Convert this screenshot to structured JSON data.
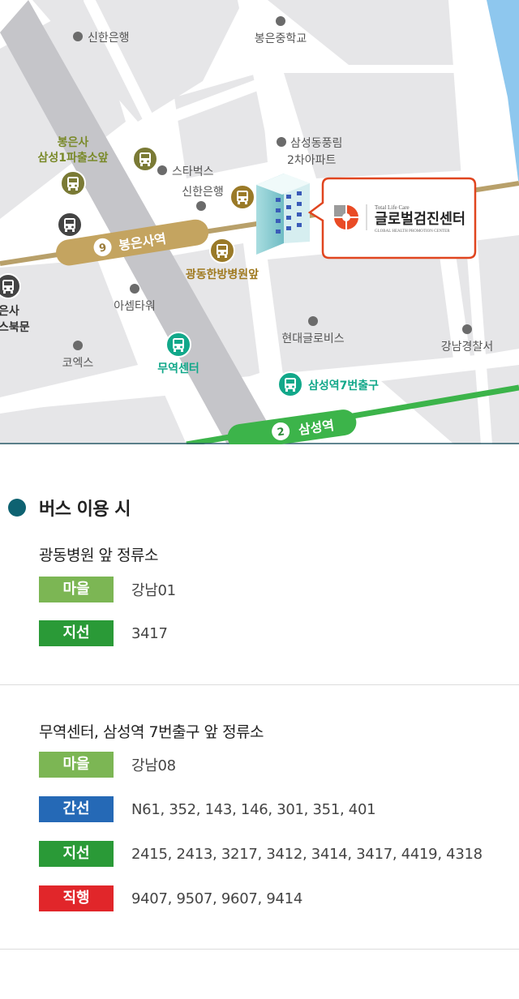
{
  "map": {
    "landmarks": [
      "신한은행",
      "봉은중학교",
      "삼성동풍림",
      "2차아파트",
      "스타벅스",
      "신한은행",
      "아셈타워",
      "현대글로비스",
      "강남경찰서",
      "코엑스"
    ],
    "bus_stops": {
      "bongeunsa": [
        "봉은사",
        "삼성1파출소앞"
      ],
      "gwangdong": "광동한방병원앞",
      "muyeok": "무역센터",
      "samseong_exit7": "삼성역7번출구",
      "edge": [
        "은사",
        "스북문"
      ]
    },
    "subway": {
      "line9": {
        "number": "9",
        "station": "봉은사역",
        "color": "#b89a52"
      },
      "line2": {
        "number": "2",
        "station": "삼성역",
        "color": "#3cb44a"
      }
    },
    "callout": {
      "tagline": "Total Life Care",
      "name": "글로벌검진센터",
      "subtitle": "GLOBAL HEALTH PROMOTION CENTER"
    }
  },
  "section": {
    "title": "버스 이용 시"
  },
  "stops": [
    {
      "name": "광동병원 앞 정류소",
      "routes": [
        {
          "type": "마을",
          "color": "#7cb654",
          "numbers": "강남01"
        },
        {
          "type": "지선",
          "color": "#2a9a37",
          "numbers": "3417"
        }
      ]
    },
    {
      "name": "무역센터, 삼성역 7번출구 앞 정류소",
      "routes": [
        {
          "type": "마을",
          "color": "#7cb654",
          "numbers": "강남08"
        },
        {
          "type": "간선",
          "color": "#2569b6",
          "numbers": "N61, 352, 143, 146, 301, 351, 401"
        },
        {
          "type": "지선",
          "color": "#2a9a37",
          "numbers": "2415, 2413, 3217, 3412, 3414, 3417, 4419, 4318"
        },
        {
          "type": "직행",
          "color": "#e1262a",
          "numbers": "9407, 9507, 9607, 9414"
        }
      ]
    }
  ]
}
